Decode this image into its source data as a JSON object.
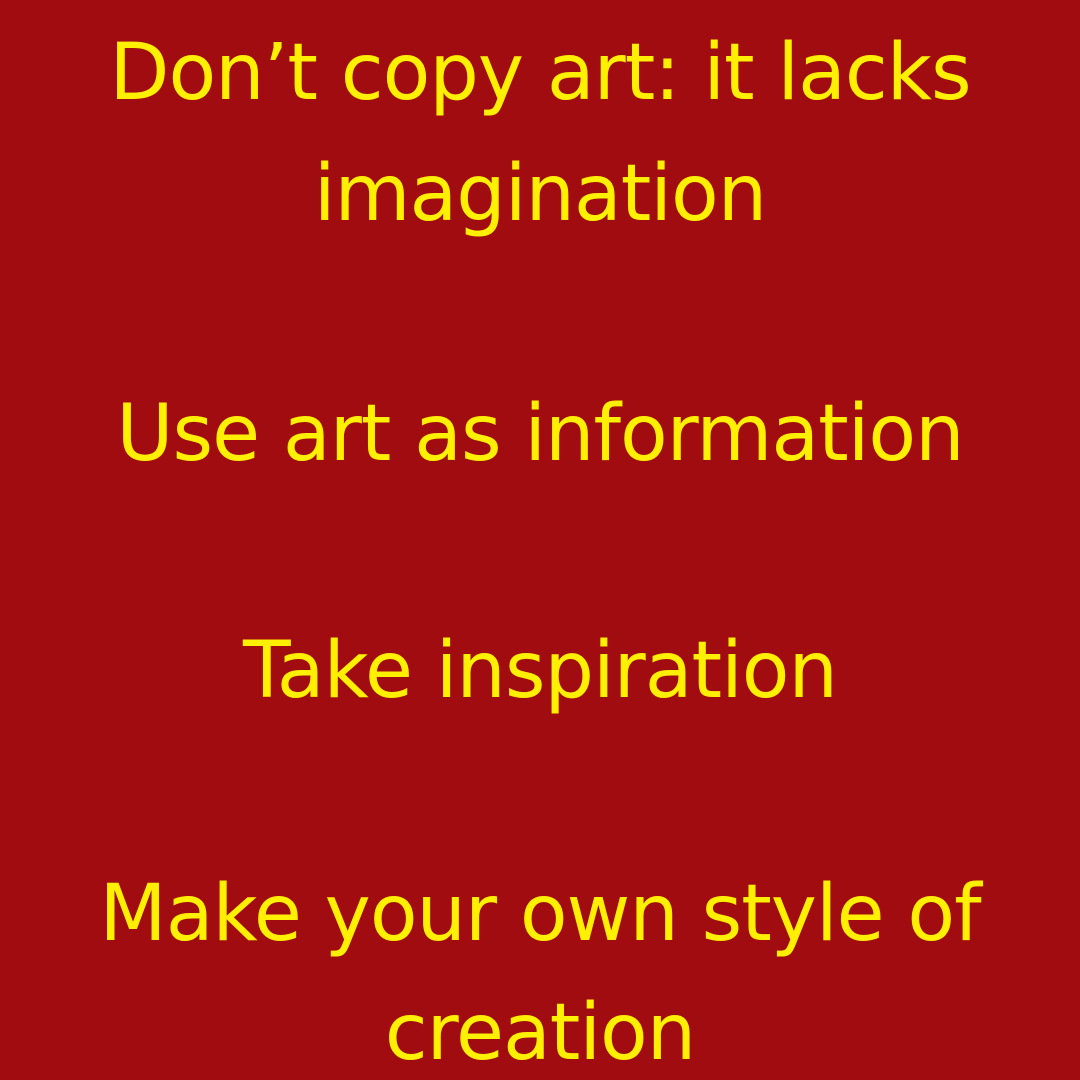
{
  "colors": {
    "background": "#a00c10",
    "text": "#ffef00"
  },
  "lines": [
    "Don’t copy art: it lacks",
    "imagination",
    "Use art as information",
    "Take inspiration",
    "Make your own style of",
    "creation"
  ]
}
